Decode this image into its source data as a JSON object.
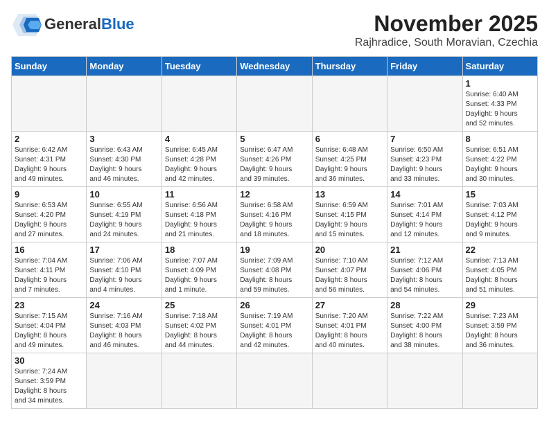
{
  "header": {
    "logo_text_general": "General",
    "logo_text_blue": "Blue",
    "month": "November 2025",
    "location": "Rajhradice, South Moravian, Czechia"
  },
  "weekdays": [
    "Sunday",
    "Monday",
    "Tuesday",
    "Wednesday",
    "Thursday",
    "Friday",
    "Saturday"
  ],
  "weeks": [
    [
      {
        "day": "",
        "info": ""
      },
      {
        "day": "",
        "info": ""
      },
      {
        "day": "",
        "info": ""
      },
      {
        "day": "",
        "info": ""
      },
      {
        "day": "",
        "info": ""
      },
      {
        "day": "",
        "info": ""
      },
      {
        "day": "1",
        "info": "Sunrise: 6:40 AM\nSunset: 4:33 PM\nDaylight: 9 hours\nand 52 minutes."
      }
    ],
    [
      {
        "day": "2",
        "info": "Sunrise: 6:42 AM\nSunset: 4:31 PM\nDaylight: 9 hours\nand 49 minutes."
      },
      {
        "day": "3",
        "info": "Sunrise: 6:43 AM\nSunset: 4:30 PM\nDaylight: 9 hours\nand 46 minutes."
      },
      {
        "day": "4",
        "info": "Sunrise: 6:45 AM\nSunset: 4:28 PM\nDaylight: 9 hours\nand 42 minutes."
      },
      {
        "day": "5",
        "info": "Sunrise: 6:47 AM\nSunset: 4:26 PM\nDaylight: 9 hours\nand 39 minutes."
      },
      {
        "day": "6",
        "info": "Sunrise: 6:48 AM\nSunset: 4:25 PM\nDaylight: 9 hours\nand 36 minutes."
      },
      {
        "day": "7",
        "info": "Sunrise: 6:50 AM\nSunset: 4:23 PM\nDaylight: 9 hours\nand 33 minutes."
      },
      {
        "day": "8",
        "info": "Sunrise: 6:51 AM\nSunset: 4:22 PM\nDaylight: 9 hours\nand 30 minutes."
      }
    ],
    [
      {
        "day": "9",
        "info": "Sunrise: 6:53 AM\nSunset: 4:20 PM\nDaylight: 9 hours\nand 27 minutes."
      },
      {
        "day": "10",
        "info": "Sunrise: 6:55 AM\nSunset: 4:19 PM\nDaylight: 9 hours\nand 24 minutes."
      },
      {
        "day": "11",
        "info": "Sunrise: 6:56 AM\nSunset: 4:18 PM\nDaylight: 9 hours\nand 21 minutes."
      },
      {
        "day": "12",
        "info": "Sunrise: 6:58 AM\nSunset: 4:16 PM\nDaylight: 9 hours\nand 18 minutes."
      },
      {
        "day": "13",
        "info": "Sunrise: 6:59 AM\nSunset: 4:15 PM\nDaylight: 9 hours\nand 15 minutes."
      },
      {
        "day": "14",
        "info": "Sunrise: 7:01 AM\nSunset: 4:14 PM\nDaylight: 9 hours\nand 12 minutes."
      },
      {
        "day": "15",
        "info": "Sunrise: 7:03 AM\nSunset: 4:12 PM\nDaylight: 9 hours\nand 9 minutes."
      }
    ],
    [
      {
        "day": "16",
        "info": "Sunrise: 7:04 AM\nSunset: 4:11 PM\nDaylight: 9 hours\nand 7 minutes."
      },
      {
        "day": "17",
        "info": "Sunrise: 7:06 AM\nSunset: 4:10 PM\nDaylight: 9 hours\nand 4 minutes."
      },
      {
        "day": "18",
        "info": "Sunrise: 7:07 AM\nSunset: 4:09 PM\nDaylight: 9 hours\nand 1 minute."
      },
      {
        "day": "19",
        "info": "Sunrise: 7:09 AM\nSunset: 4:08 PM\nDaylight: 8 hours\nand 59 minutes."
      },
      {
        "day": "20",
        "info": "Sunrise: 7:10 AM\nSunset: 4:07 PM\nDaylight: 8 hours\nand 56 minutes."
      },
      {
        "day": "21",
        "info": "Sunrise: 7:12 AM\nSunset: 4:06 PM\nDaylight: 8 hours\nand 54 minutes."
      },
      {
        "day": "22",
        "info": "Sunrise: 7:13 AM\nSunset: 4:05 PM\nDaylight: 8 hours\nand 51 minutes."
      }
    ],
    [
      {
        "day": "23",
        "info": "Sunrise: 7:15 AM\nSunset: 4:04 PM\nDaylight: 8 hours\nand 49 minutes."
      },
      {
        "day": "24",
        "info": "Sunrise: 7:16 AM\nSunset: 4:03 PM\nDaylight: 8 hours\nand 46 minutes."
      },
      {
        "day": "25",
        "info": "Sunrise: 7:18 AM\nSunset: 4:02 PM\nDaylight: 8 hours\nand 44 minutes."
      },
      {
        "day": "26",
        "info": "Sunrise: 7:19 AM\nSunset: 4:01 PM\nDaylight: 8 hours\nand 42 minutes."
      },
      {
        "day": "27",
        "info": "Sunrise: 7:20 AM\nSunset: 4:01 PM\nDaylight: 8 hours\nand 40 minutes."
      },
      {
        "day": "28",
        "info": "Sunrise: 7:22 AM\nSunset: 4:00 PM\nDaylight: 8 hours\nand 38 minutes."
      },
      {
        "day": "29",
        "info": "Sunrise: 7:23 AM\nSunset: 3:59 PM\nDaylight: 8 hours\nand 36 minutes."
      }
    ],
    [
      {
        "day": "30",
        "info": "Sunrise: 7:24 AM\nSunset: 3:59 PM\nDaylight: 8 hours\nand 34 minutes."
      },
      {
        "day": "",
        "info": ""
      },
      {
        "day": "",
        "info": ""
      },
      {
        "day": "",
        "info": ""
      },
      {
        "day": "",
        "info": ""
      },
      {
        "day": "",
        "info": ""
      },
      {
        "day": "",
        "info": ""
      }
    ]
  ]
}
